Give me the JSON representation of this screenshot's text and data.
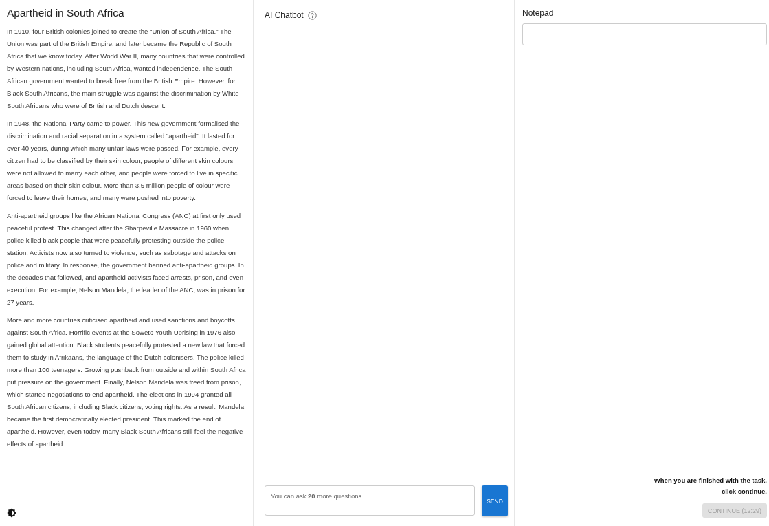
{
  "article": {
    "title": "Apartheid in South Africa",
    "paragraphs": [
      "In 1910, four British colonies joined to create the \"Union of South Africa.\" The Union was part of the British Empire, and later became the Republic of South Africa that we know today. After World War II, many countries that were controlled by Western nations, including South Africa, wanted independence. The South African government wanted to break free from the British Empire. However, for Black South Africans, the main struggle was against the discrimination by White South Africans who were of British and Dutch descent.",
      "In 1948, the National Party came to power. This new government formalised the discrimination and racial separation in a system called \"apartheid\". It lasted for over 40 years, during which many unfair laws were passed. For example, every citizen had to be classified by their skin colour, people of different skin colours were not allowed to marry each other, and people were forced to live in specific areas based on their skin colour. More than 3.5 million people of colour were forced to leave their homes, and many were pushed into poverty.",
      "Anti-apartheid groups like the African National Congress (ANC) at first only used peaceful protest. This changed after the Sharpeville Massacre in 1960 when police killed black people that were peacefully protesting outside the police station. Activists now also turned to violence, such as sabotage and attacks on police and military. In response, the government banned anti-apartheid groups. In the decades that followed, anti-apartheid activists faced arrests, prison, and even execution. For example, Nelson Mandela, the leader of the ANC, was in prison for 27 years.",
      "More and more countries criticised apartheid and used sanctions and boycotts against South Africa. Horrific events at the Soweto Youth Uprising in 1976 also gained global attention. Black students peacefully protested a new law that forced them to study in Afrikaans, the language of the Dutch colonisers. The police killed more than 100 teenagers. Growing pushback from outside and within South Africa put pressure on the government. Finally, Nelson Mandela was freed from prison, which started negotiations to end apartheid. The elections in 1994 granted all South African citizens, including Black citizens, voting rights. As a result, Mandela became the first democratically elected president. This marked the end of apartheid. However, even today, many Black South Africans still feel the negative effects of apartheid."
    ]
  },
  "chatbot": {
    "title": "AI Chatbot",
    "placeholder": "You can ask **20** more questions.",
    "send_button": "SEND"
  },
  "notepad": {
    "title": "Notepad"
  },
  "footer": {
    "instruction": "When you are finished with the task, click continue.",
    "continue_button": {
      "label": "CONTINUE (12:29)",
      "disabled": true
    }
  }
}
